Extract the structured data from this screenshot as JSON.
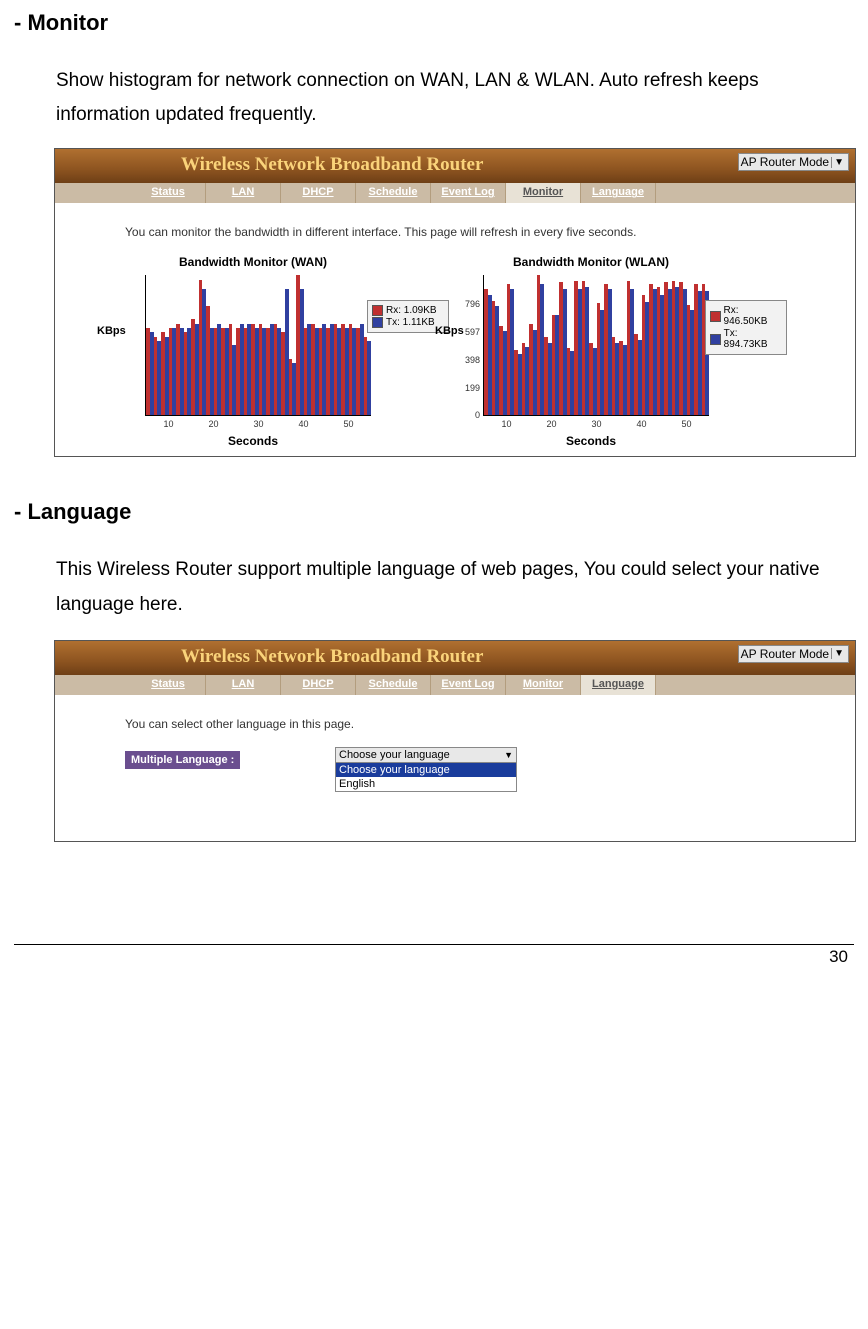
{
  "sections": {
    "monitor": {
      "heading": "- Monitor",
      "para": "Show histogram for network connection on WAN, LAN & WLAN. Auto refresh keeps information updated frequently."
    },
    "language": {
      "heading": "- Language",
      "para": "This Wireless Router support multiple language of web pages, You could select your native language here."
    }
  },
  "router": {
    "banner": "Wireless Network Broadband Router",
    "mode": "AP Router Mode",
    "tabs": [
      "Status",
      "LAN",
      "DHCP",
      "Schedule",
      "Event Log",
      "Monitor",
      "Language"
    ]
  },
  "monitor_shot": {
    "active_tab": "Monitor",
    "intro": "You can monitor the bandwidth in different interface. This page will refresh in every five seconds.",
    "y_label": "KBps",
    "x_label": "Seconds",
    "x_ticks": [
      "10",
      "20",
      "30",
      "40",
      "50"
    ],
    "wan": {
      "title": "Bandwidth Monitor (WAN)",
      "y_ticks": [],
      "legend": {
        "rx": "Rx: 1.09KB",
        "tx": "Tx: 1.11KB"
      }
    },
    "wlan": {
      "title": "Bandwidth Monitor (WLAN)",
      "y_ticks": [
        "796",
        "597",
        "398",
        "199",
        "0"
      ],
      "legend": {
        "rx": "Rx: 946.50KB",
        "tx": "Tx: 894.73KB"
      }
    }
  },
  "language_shot": {
    "active_tab": "Language",
    "intro": "You can select other language in this page.",
    "label": "Multiple Language :",
    "selected": "Choose your language",
    "options": [
      "Choose your language",
      "English"
    ]
  },
  "page_number": "30",
  "chart_data": [
    {
      "type": "bar",
      "title": "Bandwidth Monitor (WAN)",
      "xlabel": "Seconds",
      "ylabel": "KBps",
      "x_ticks": [
        10,
        20,
        30,
        40,
        50
      ],
      "ylim": [
        0,
        1.6
      ],
      "legend": [
        "Rx: 1.09KB",
        "Tx: 1.11KB"
      ],
      "series": [
        {
          "name": "Rx",
          "values": [
            1.0,
            0.9,
            0.95,
            1.0,
            1.05,
            0.95,
            1.1,
            1.55,
            1.25,
            1.0,
            1.0,
            1.05,
            1.0,
            1.0,
            1.05,
            1.05,
            1.0,
            1.05,
            0.95,
            0.65,
            1.6,
            1.0,
            1.05,
            1.0,
            1.0,
            1.05,
            1.05,
            1.05,
            1.0,
            0.9
          ]
        },
        {
          "name": "Tx",
          "values": [
            0.95,
            0.85,
            0.9,
            1.0,
            1.0,
            1.0,
            1.05,
            1.45,
            1.0,
            1.05,
            1.0,
            0.8,
            1.05,
            1.05,
            1.0,
            1.0,
            1.05,
            1.0,
            1.45,
            0.6,
            1.45,
            1.05,
            1.0,
            1.05,
            1.05,
            1.0,
            1.0,
            1.0,
            1.05,
            0.85
          ]
        }
      ]
    },
    {
      "type": "bar",
      "title": "Bandwidth Monitor (WLAN)",
      "xlabel": "Seconds",
      "ylabel": "KBps",
      "x_ticks": [
        10,
        20,
        30,
        40,
        50
      ],
      "y_ticks": [
        0,
        199,
        398,
        597,
        796
      ],
      "ylim": [
        0,
        1000
      ],
      "legend": [
        "Rx: 946.50KB",
        "Tx: 894.73KB"
      ],
      "series": [
        {
          "name": "Rx",
          "values": [
            900,
            820,
            640,
            940,
            470,
            520,
            650,
            1000,
            560,
            720,
            950,
            480,
            960,
            960,
            520,
            800,
            940,
            560,
            530,
            960,
            580,
            860,
            940,
            920,
            950,
            960,
            950,
            790,
            940,
            940
          ]
        },
        {
          "name": "Tx",
          "values": [
            860,
            780,
            600,
            900,
            440,
            490,
            610,
            940,
            520,
            720,
            900,
            460,
            900,
            920,
            480,
            750,
            900,
            520,
            500,
            900,
            540,
            810,
            900,
            860,
            900,
            920,
            900,
            750,
            890,
            890
          ]
        }
      ]
    }
  ]
}
